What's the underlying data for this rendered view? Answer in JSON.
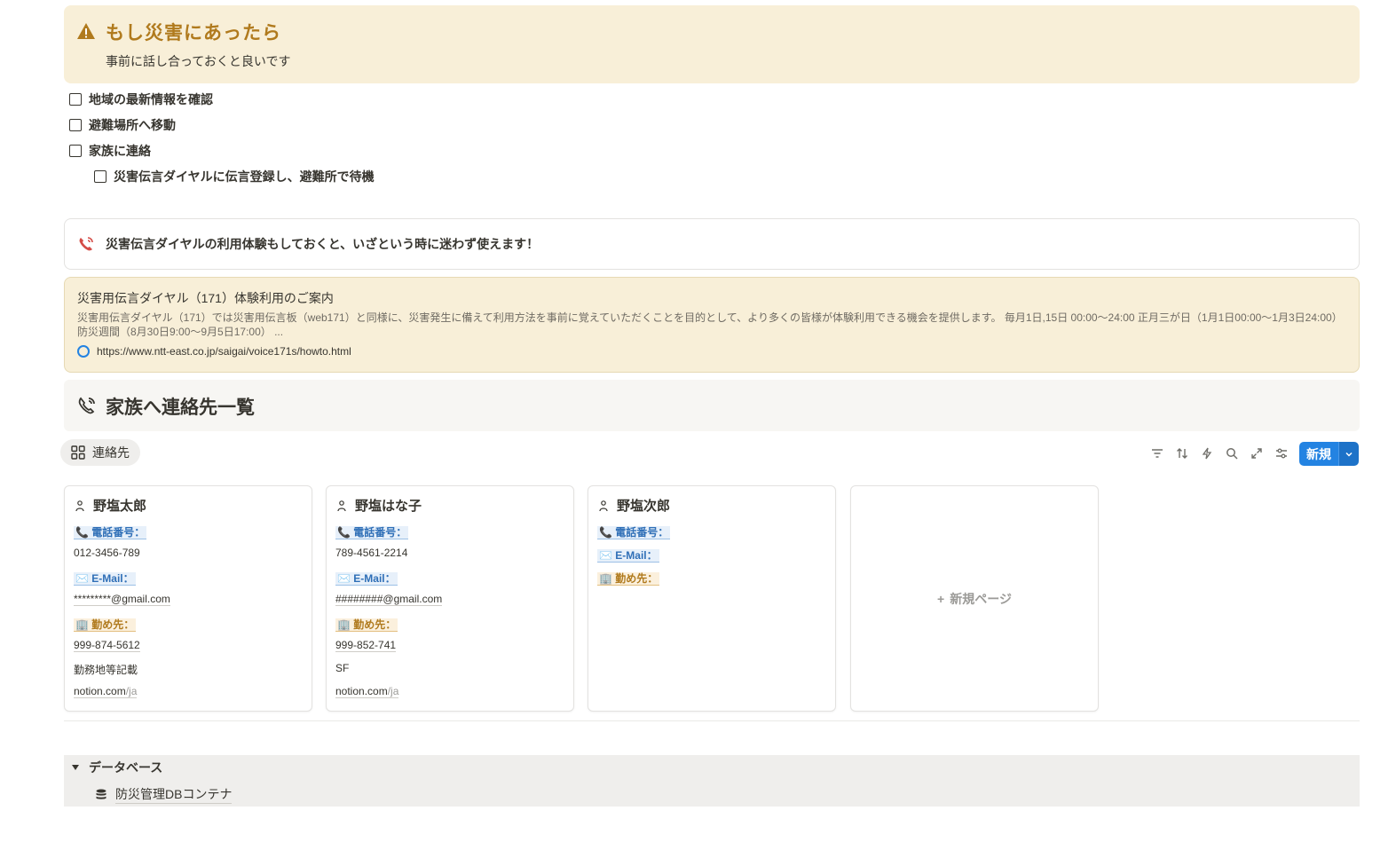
{
  "callout": {
    "title": "もし災害にあったら",
    "subtitle": "事前に話し合っておくと良いです",
    "icon": "warning-icon"
  },
  "todos": [
    {
      "label": "地域の最新情報を確認",
      "checked": false
    },
    {
      "label": "避難場所へ移動",
      "checked": false
    },
    {
      "label": "家族に連絡",
      "checked": false
    },
    {
      "label": "災害伝言ダイヤルに伝言登録し、避難所で待機",
      "checked": false
    }
  ],
  "tip": {
    "text": "災害伝言ダイヤルの利用体験もしておくと、いざという時に迷わず使えます！",
    "icon": "phone-icon"
  },
  "bookmark": {
    "title": "災害用伝言ダイヤル（171）体験利用のご案内",
    "description": "災害用伝言ダイヤル（171）では災害用伝言板（web171）と同様に、災害発生に備えて利用方法を事前に覚えていただくことを目的として、より多くの皆様が体験利用できる機会を提供します。 毎月1日,15日 00:00〜24:00 正月三が日（1月1日00:00〜1月3日24:00）防災週間（8月30日9:00〜9月5日17:00） ...",
    "url": "https://www.ntt-east.co.jp/saigai/voice171s/howto.html"
  },
  "section": {
    "title": "家族へ連絡先一覧",
    "view_label": "連絡先",
    "new_button": "新規"
  },
  "cards": [
    {
      "name": "野塩太郎",
      "phone_label": "📞 電話番号：",
      "phone": "012-3456-789",
      "email_label": "✉️ E-Mail：",
      "email": "*********@gmail.com",
      "work_label": "🏢 勤め先：",
      "work_phone": "999-874-5612",
      "work_note": "勤務地等記載",
      "link_domain": "notion.com",
      "link_path": "/ja"
    },
    {
      "name": "野塩はな子",
      "phone_label": "📞 電話番号：",
      "phone": "789-4561-2214",
      "email_label": "✉️ E-Mail：",
      "email": "########@gmail.com",
      "work_label": "🏢 勤め先：",
      "work_phone": "999-852-741",
      "work_note": "SF",
      "link_domain": "notion.com",
      "link_path": "/ja"
    },
    {
      "name": "野塩次郎",
      "phone_label": "📞 電話番号：",
      "email_label": "✉️ E-Mail：",
      "work_label": "🏢 勤め先："
    }
  ],
  "new_page_label": "新規ページ",
  "database_toggle": {
    "label": "データベース",
    "item": "防災管理DBコンテナ"
  },
  "colors": {
    "accent": "#2383e2",
    "callout_bg": "#f8efd8",
    "callout_title": "#b07a1d",
    "phone_red": "#d44c47"
  }
}
